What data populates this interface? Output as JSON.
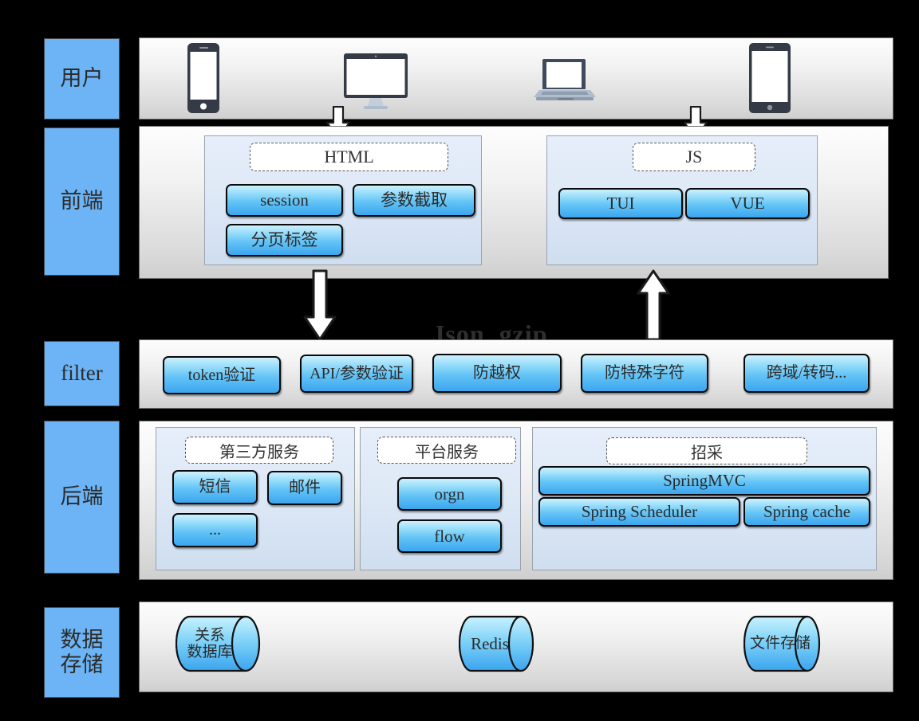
{
  "diagram": {
    "caption": "Json  gzip",
    "colors": {
      "stage_blue": "#6CB4F5",
      "button_top": "#cdf0fd",
      "button_bottom": "#3ba5ef",
      "group_panel": "#dde8f6",
      "row_panel": "#f2f2f2",
      "caption_color": "#2f2f2f"
    }
  },
  "stages": [
    {
      "label": "用户"
    },
    {
      "label": "前端"
    },
    {
      "label": "filter"
    },
    {
      "label": "后端"
    },
    {
      "label": "数据\n存储"
    }
  ],
  "user_row": {
    "devices": [
      {
        "name": "smartphone"
      },
      {
        "name": "desktop-monitor"
      },
      {
        "name": "laptop"
      },
      {
        "name": "tablet"
      }
    ]
  },
  "frontend_row": {
    "groups": [
      {
        "title": "HTML",
        "items": [
          {
            "label": "session"
          },
          {
            "label": "参数截取"
          },
          {
            "label": "分页标签"
          }
        ]
      },
      {
        "title": "JS",
        "items": [
          {
            "label": "TUI"
          },
          {
            "label": "VUE"
          }
        ]
      }
    ]
  },
  "filter_row": {
    "items": [
      {
        "label": "token验证"
      },
      {
        "label": "API/参数验证"
      },
      {
        "label": "防越权"
      },
      {
        "label": "防特殊字符"
      },
      {
        "label": "跨域/转码..."
      }
    ]
  },
  "backend_row": {
    "groups": [
      {
        "title": "第三方服务",
        "items": [
          {
            "label": "短信"
          },
          {
            "label": "邮件"
          },
          {
            "label": "..."
          }
        ]
      },
      {
        "title": "平台服务",
        "items": [
          {
            "label": "orgn"
          },
          {
            "label": "flow"
          }
        ]
      },
      {
        "title": "招采",
        "items": [
          {
            "label": "SpringMVC"
          },
          {
            "label": "Spring Scheduler"
          },
          {
            "label": "Spring cache"
          }
        ]
      }
    ]
  },
  "storage_row": {
    "items": [
      {
        "label": "关系\n数据库"
      },
      {
        "label": "Redis"
      },
      {
        "label": "文件存储"
      }
    ]
  }
}
